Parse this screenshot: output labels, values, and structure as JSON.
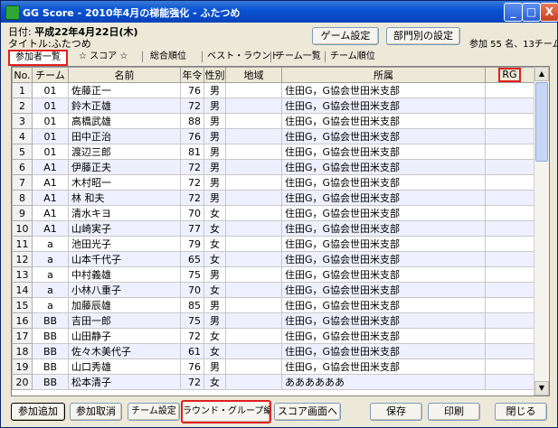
{
  "window": {
    "title": "GG Score - 2010年4月の梯能強化 - ふたつめ",
    "minimize": "_",
    "maximize": "□",
    "close": "X"
  },
  "header": {
    "date_label": "日付:",
    "date_value": "平成22年4月22日(木)",
    "title_label": "タイトル:",
    "title_value": "ふたつめ",
    "game_settings_button": "ゲーム設定",
    "dept_settings_button": "部門別の設定",
    "participants_info": "参加 55 名、13チーム"
  },
  "tabs": [
    {
      "label": "参加者一覧",
      "selected": true
    },
    {
      "label": "☆ スコア ☆",
      "selected": false
    },
    {
      "label": "総合順位",
      "selected": false
    },
    {
      "label": "ベスト・ラウンド",
      "selected": false
    },
    {
      "label": "チーム一覧",
      "selected": false
    },
    {
      "label": "チーム順位",
      "selected": false
    }
  ],
  "table": {
    "columns": [
      "No.",
      "チーム",
      "名前",
      "年令",
      "性別",
      "地域",
      "所属",
      "RG"
    ],
    "rows": [
      [
        "1",
        "01",
        "佐藤正一",
        "76",
        "男",
        "",
        "住田G，G協会世田米支部",
        ""
      ],
      [
        "2",
        "01",
        "鈴木正雄",
        "72",
        "男",
        "",
        "住田G，G協会世田米支部",
        ""
      ],
      [
        "3",
        "01",
        "高橋武雄",
        "88",
        "男",
        "",
        "住田G，G協会世田米支部",
        ""
      ],
      [
        "4",
        "01",
        "田中正治",
        "76",
        "男",
        "",
        "住田G，G協会世田米支部",
        ""
      ],
      [
        "5",
        "01",
        "渡辺三郎",
        "81",
        "男",
        "",
        "住田G，G協会世田米支部",
        ""
      ],
      [
        "6",
        "A1",
        "伊藤正夫",
        "72",
        "男",
        "",
        "住田G，G協会世田米支部",
        ""
      ],
      [
        "7",
        "A1",
        "木村昭一",
        "72",
        "男",
        "",
        "住田G，G協会世田米支部",
        ""
      ],
      [
        "8",
        "A1",
        "林 和夫",
        "72",
        "男",
        "",
        "住田G，G協会世田米支部",
        ""
      ],
      [
        "9",
        "A1",
        "清水キヨ",
        "70",
        "女",
        "",
        "住田G，G協会世田米支部",
        ""
      ],
      [
        "10",
        "A1",
        "山崎実子",
        "77",
        "女",
        "",
        "住田G，G協会世田米支部",
        ""
      ],
      [
        "11",
        "a",
        "池田光子",
        "79",
        "女",
        "",
        "住田G，G協会世田米支部",
        ""
      ],
      [
        "12",
        "a",
        "山本千代子",
        "65",
        "女",
        "",
        "住田G，G協会世田米支部",
        ""
      ],
      [
        "13",
        "a",
        "中村義雄",
        "75",
        "男",
        "",
        "住田G，G協会世田米支部",
        ""
      ],
      [
        "14",
        "a",
        "小林八重子",
        "70",
        "女",
        "",
        "住田G，G協会世田米支部",
        ""
      ],
      [
        "15",
        "a",
        "加藤辰雄",
        "85",
        "男",
        "",
        "住田G，G協会世田米支部",
        ""
      ],
      [
        "16",
        "BB",
        "吉田一郎",
        "75",
        "男",
        "",
        "住田G，G協会世田米支部",
        ""
      ],
      [
        "17",
        "BB",
        "山田静子",
        "72",
        "女",
        "",
        "住田G，G協会世田米支部",
        ""
      ],
      [
        "18",
        "BB",
        "佐々木美代子",
        "61",
        "女",
        "",
        "住田G，G協会世田米支部",
        ""
      ],
      [
        "19",
        "BB",
        "山口秀雄",
        "76",
        "男",
        "",
        "住田G，G協会世田米支部",
        ""
      ],
      [
        "20",
        "BB",
        "松本清子",
        "72",
        "女",
        "",
        "ああああああ",
        ""
      ]
    ]
  },
  "bottom": {
    "add_participant": "参加追加",
    "cancel_participant": "参加取消",
    "team_settings": "チーム設定",
    "round_group": "ラウンド・グループ編成",
    "score_screen": "スコア画面へ",
    "save": "保存",
    "print": "印刷",
    "close": "閉じる"
  },
  "colors": {
    "highlight": "#e02020",
    "titlebar": "#0a54d6"
  }
}
